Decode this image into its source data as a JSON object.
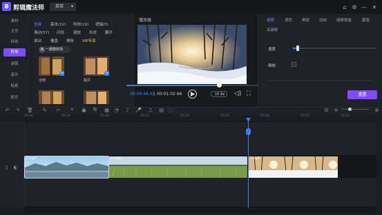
{
  "app": {
    "title": "剪辑魔法师",
    "menu_label": "菜单",
    "logo_letter": "B"
  },
  "left_nav": [
    "素材",
    "文字",
    "特效",
    "转场",
    "滤镜",
    "音乐",
    "贴纸",
    "配乐"
  ],
  "left_nav_active": 3,
  "library": {
    "categories_row1": [
      "全部",
      "基本(32)",
      "特效(19)",
      "遮幅(5)"
    ],
    "categories_row2": [
      "滑动(57)",
      "闪烁",
      "缩放",
      "形状",
      "翻开"
    ],
    "categories_row3": [
      "滚动",
      "覆盖",
      "擦除",
      "VIP专享"
    ],
    "one_key_label": "一键删转场",
    "items": [
      {
        "label": "溶暗"
      },
      {
        "label": "翻页"
      },
      {
        "label": ""
      },
      {
        "label": ""
      }
    ]
  },
  "player": {
    "title": "播放器",
    "current_time": "00:00:44.63",
    "separator": "/",
    "total_time": "00:01:02.66",
    "progress": 0.71,
    "ratio": "16:9"
  },
  "properties": {
    "tabs": [
      "视频",
      "调色",
      "美颜",
      "动效",
      "绿屏抠像",
      "蒙版",
      "关键帧"
    ],
    "active_tab": 0,
    "speed_label": "速度",
    "speed_value": 0.06,
    "reverse_label": "倒放",
    "reset_label": "重置"
  },
  "timeline": {
    "ticks": [
      "00:00",
      "00:20",
      "00:44",
      "00:14",
      "00:24",
      "00:32",
      "00:40",
      "00:50",
      "00:58",
      "01:04"
    ],
    "clips": [
      {
        "label": "1.mp4"
      },
      {
        "label": "2.mp4"
      },
      {
        "label": "3.mp4"
      }
    ],
    "zoom_level": 0.3
  },
  "colors": {
    "accent": "#7b4dff",
    "highlight": "#3a7bff",
    "vip": "#ffc83d"
  },
  "icons": [
    "undo-icon",
    "redo-icon",
    "delete-icon",
    "edit-icon",
    "split-icon",
    "crop-icon",
    "freeze-icon",
    "copy-icon",
    "speed-icon",
    "mute-icon",
    "mosaic-icon",
    "play-icon",
    "volume-icon",
    "fullscreen-icon",
    "zoom-in-icon",
    "zoom-out-icon"
  ]
}
